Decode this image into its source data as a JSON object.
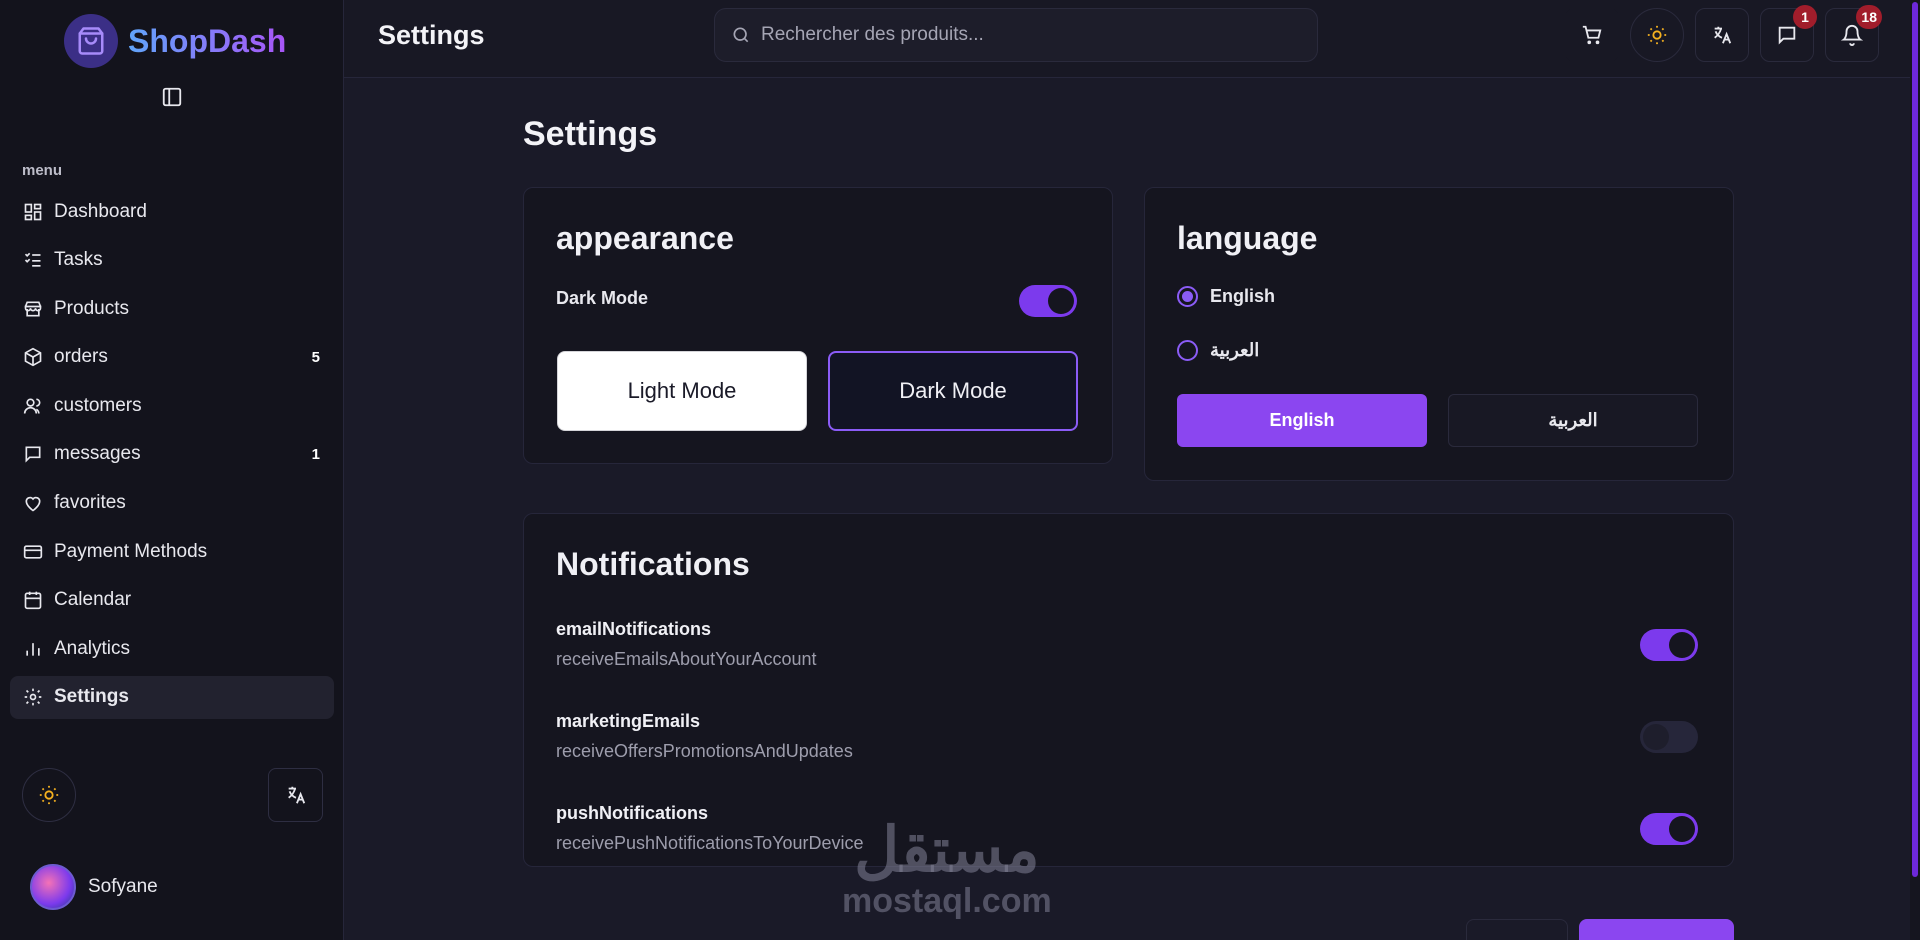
{
  "colors": {
    "accent": "#8b5cf6",
    "badge": "#a11d2b",
    "background": "#1a1a28",
    "sidebar": "#13131c"
  },
  "brand": {
    "name": "ShopDash",
    "icon": "shopping-bag-icon"
  },
  "sidebar": {
    "menu_label": "menu",
    "items": [
      {
        "label": "Dashboard",
        "icon": "dashboard-grid-icon",
        "count": ""
      },
      {
        "label": "Tasks",
        "icon": "tasks-list-icon",
        "count": ""
      },
      {
        "label": "Products",
        "icon": "store-icon",
        "count": ""
      },
      {
        "label": "orders",
        "icon": "package-icon",
        "count": "5"
      },
      {
        "label": "customers",
        "icon": "users-icon",
        "count": ""
      },
      {
        "label": "messages",
        "icon": "message-icon",
        "count": "1"
      },
      {
        "label": "favorites",
        "icon": "heart-icon",
        "count": ""
      },
      {
        "label": "Payment Methods",
        "icon": "credit-card-icon",
        "count": ""
      },
      {
        "label": "Calendar",
        "icon": "calendar-icon",
        "count": ""
      },
      {
        "label": "Analytics",
        "icon": "bar-chart-icon",
        "count": ""
      },
      {
        "label": "Settings",
        "icon": "gear-icon",
        "count": "",
        "active": true
      }
    ],
    "user": {
      "name": "Sofyane"
    }
  },
  "header": {
    "title": "Settings",
    "search_placeholder": "Rechercher des produits...",
    "messages_badge": "1",
    "notifications_badge": "18"
  },
  "page": {
    "title": "Settings",
    "appearance": {
      "title": "appearance",
      "dark_mode_label": "Dark Mode",
      "dark_mode_on": true,
      "light_mode_button": "Light Mode",
      "dark_mode_button": "Dark Mode"
    },
    "language": {
      "title": "language",
      "options": [
        {
          "label": "English",
          "selected": true
        },
        {
          "label": "العربية",
          "selected": false
        }
      ],
      "english_button": "English",
      "arabic_button": "العربية"
    },
    "notifications": {
      "title": "Notifications",
      "items": [
        {
          "title": "emailNotifications",
          "description": "receiveEmailsAboutYourAccount",
          "enabled": true
        },
        {
          "title": "marketingEmails",
          "description": "receiveOffersPromotionsAndUpdates",
          "enabled": false
        },
        {
          "title": "pushNotifications",
          "description": "receivePushNotificationsToYourDevice",
          "enabled": true
        }
      ]
    }
  },
  "watermark": {
    "arabic": "مستقل",
    "latin": "mostaql.com"
  }
}
